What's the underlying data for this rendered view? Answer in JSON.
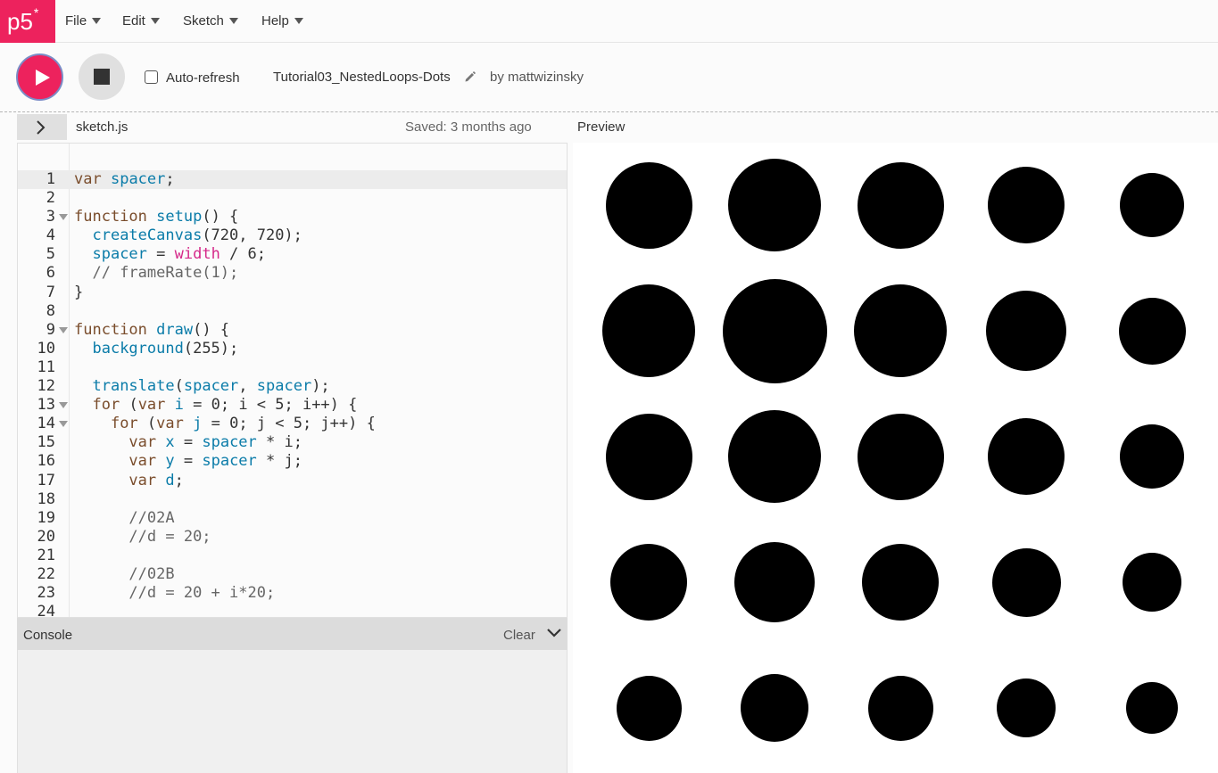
{
  "nav": {
    "logo": "p5",
    "logo_sup": "*",
    "menus": [
      "File",
      "Edit",
      "Sketch",
      "Help"
    ]
  },
  "toolbar": {
    "auto_refresh_label": "Auto-refresh",
    "auto_refresh_checked": false,
    "sketch_name": "Tutorial03_NestedLoops-Dots",
    "by_user": "by mattwizinsky"
  },
  "editor": {
    "file_name": "sketch.js",
    "saved_status": "Saved: 3 months ago",
    "lines": [
      "var spacer;",
      "",
      "function setup() {",
      "  createCanvas(720, 720);",
      "  spacer = width / 6;",
      "  // frameRate(1);",
      "}",
      "",
      "function draw() {",
      "  background(255);",
      "",
      "  translate(spacer, spacer);",
      "  for (var i = 0; i < 5; i++) {",
      "    for (var j = 0; j < 5; j++) {",
      "      var x = spacer * i;",
      "      var y = spacer * j;",
      "      var d;",
      "",
      "      //02A",
      "      //d = 20;",
      "",
      "      //02B",
      "      //d = 20 + i*20;",
      ""
    ],
    "fold_lines": [
      3,
      9,
      13,
      14
    ]
  },
  "console": {
    "title": "Console",
    "clear_label": "Clear"
  },
  "preview": {
    "label": "Preview",
    "grid_rows": 5,
    "grid_cols": 5,
    "dot_color": "#000000",
    "diameters": [
      [
        97,
        104,
        97,
        86,
        72
      ],
      [
        104,
        117,
        104,
        90,
        75
      ],
      [
        97,
        104,
        97,
        86,
        72
      ],
      [
        86,
        90,
        86,
        77,
        66
      ],
      [
        73,
        76,
        73,
        66,
        58
      ]
    ]
  },
  "colors": {
    "accent": "#ed225d",
    "keyword": "#7a4d2c",
    "function": "#0b7ca9",
    "builtin": "#d52889",
    "comment": "#666666"
  }
}
